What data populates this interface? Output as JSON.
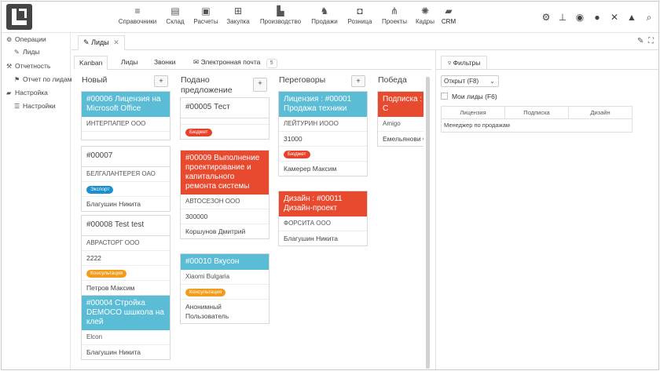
{
  "app": {
    "logo": "logo"
  },
  "topnav": [
    {
      "label": "Справочники",
      "icon": "≡"
    },
    {
      "label": "Склад",
      "icon": "▤"
    },
    {
      "label": "Расчеты",
      "icon": "▣"
    },
    {
      "label": "Закупка",
      "icon": "⊞"
    },
    {
      "label": "Производство",
      "icon": "▙"
    },
    {
      "label": "Продажи",
      "icon": "♞"
    },
    {
      "label": "Розница",
      "icon": "◘"
    },
    {
      "label": "Проекты",
      "icon": "⋔"
    },
    {
      "label": "Кадры",
      "icon": "✺"
    },
    {
      "label": "CRM",
      "icon": "▰"
    }
  ],
  "toolbar_icons": [
    "gear-icon",
    "pin-icon",
    "eye-icon",
    "chat-icon",
    "tools-icon",
    "lock-icon",
    "search-icon"
  ],
  "sidebar": {
    "items": [
      {
        "label": "Операции",
        "icon": "⚙"
      },
      {
        "label": "Лиды",
        "icon": "✎"
      },
      {
        "label": "Отчетность",
        "icon": "⚒"
      },
      {
        "label": "Отчет по лидам",
        "icon": "⚑"
      },
      {
        "label": "Настройка",
        "icon": "▰"
      },
      {
        "label": "Настройки",
        "icon": "☰"
      }
    ]
  },
  "page_tab": {
    "label": "Лиды",
    "close": "✕"
  },
  "subtabs": [
    {
      "label": "Kanban"
    },
    {
      "label": "Лиды"
    },
    {
      "label": "Звонки"
    },
    {
      "label": "Электронная почта",
      "count": "5"
    }
  ],
  "columns": [
    {
      "title": "Новый",
      "add": "+",
      "cards": [
        {
          "title": "#00006 Лицензия на Microsoft Office",
          "style": "blue",
          "rows": [
            "ИНТЕРПАПЕР ООО"
          ]
        },
        {
          "title": "#00007",
          "style": "plain",
          "rows": [
            "БЕЛГАЛАНТЕРЕЯ ОАО"
          ],
          "pill": {
            "text": "Экспорт",
            "color": "blue"
          },
          "person": "Благушин Никита"
        },
        {
          "title": "#00008 Test test",
          "style": "plain",
          "rows": [
            "АВРАСТОРГ ООО",
            "2222"
          ],
          "pill": {
            "text": "Консультация",
            "color": "orange"
          },
          "person": "Петров Максим"
        },
        {
          "title": "#00004 Стройка DEMOCO шшкола на клей",
          "style": "blue",
          "rows": [
            "Elcon"
          ],
          "person": "Благушин Никита"
        }
      ]
    },
    {
      "title": "Подано предложение",
      "add": "+",
      "cards": [
        {
          "title": "#00005 Тест",
          "style": "plain",
          "pill": {
            "text": "Бюджет",
            "color": "red"
          }
        },
        {
          "title": "#00009 Выполнение проектирование и капитального ремонта системы",
          "style": "red",
          "rows": [
            "АВТОСЕЗОН ООО",
            "300000"
          ],
          "person": "Коршунов Дмитрий"
        },
        {
          "title": "#00010 Вкусон",
          "style": "blue",
          "rows": [
            "Xiaomi Bulgaria"
          ],
          "pill": {
            "text": "Консультация",
            "color": "orange"
          },
          "person": "Анонимный Пользователь"
        }
      ]
    },
    {
      "title": "Переговоры",
      "add": "+",
      "cards": [
        {
          "title": "Лицензия : #00001 Продажа техники",
          "style": "blue",
          "rows": [
            "ЛЕЙТУРИН ИООО",
            "31000"
          ],
          "pill": {
            "text": "Бюджет",
            "color": "red"
          },
          "person": "Камерер Максим"
        },
        {
          "title": "Дизайн : #00011 Дизайн-проект",
          "style": "red",
          "rows": [
            "ФОРСИТА ООО"
          ],
          "person": "Благушин Никита"
        }
      ]
    },
    {
      "title": "Победа",
      "cards": [
        {
          "title": "Подписка : Стройка С",
          "style": "red",
          "rows": [
            "Amigo"
          ],
          "person": "Емельянови Станиславо"
        }
      ]
    }
  ],
  "filters": {
    "tab": "Фильтры",
    "select": "Открыт (F8)",
    "checkbox": "Мои лиды (F6)",
    "headers": [
      "Лицензия",
      "Подписка",
      "Дизайн"
    ],
    "row": "Менеджер по продажам"
  }
}
